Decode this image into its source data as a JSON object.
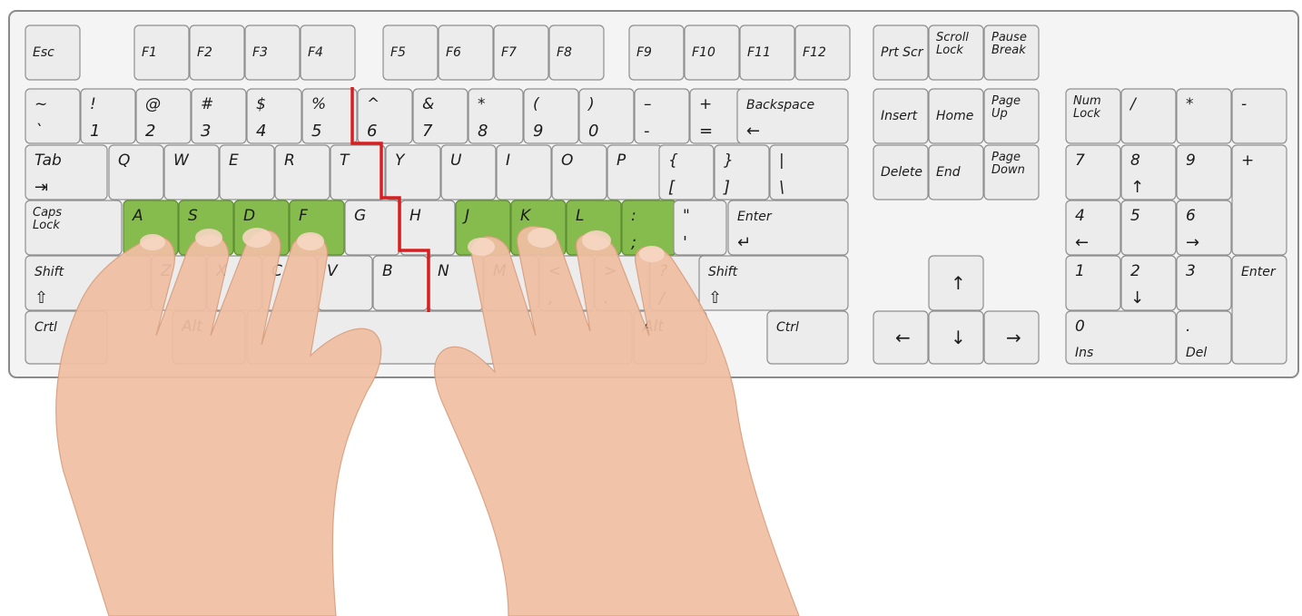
{
  "keyboard": {
    "home_key_color": "#86bb4e",
    "divider_color": "#d81e1e",
    "function_row": [
      {
        "id": "esc",
        "lines": [
          "Esc"
        ]
      },
      {
        "id": "f1",
        "lines": [
          "F1"
        ]
      },
      {
        "id": "f2",
        "lines": [
          "F2"
        ]
      },
      {
        "id": "f3",
        "lines": [
          "F3"
        ]
      },
      {
        "id": "f4",
        "lines": [
          "F4"
        ]
      },
      {
        "id": "f5",
        "lines": [
          "F5"
        ]
      },
      {
        "id": "f6",
        "lines": [
          "F6"
        ]
      },
      {
        "id": "f7",
        "lines": [
          "F7"
        ]
      },
      {
        "id": "f8",
        "lines": [
          "F8"
        ]
      },
      {
        "id": "f9",
        "lines": [
          "F9"
        ]
      },
      {
        "id": "f10",
        "lines": [
          "F10"
        ]
      },
      {
        "id": "f11",
        "lines": [
          "F11"
        ]
      },
      {
        "id": "f12",
        "lines": [
          "F12"
        ]
      }
    ],
    "number_row": [
      {
        "id": "tilde",
        "top": "~",
        "bottom": "`"
      },
      {
        "id": "1",
        "top": "!",
        "bottom": "1"
      },
      {
        "id": "2",
        "top": "@",
        "bottom": "2"
      },
      {
        "id": "3",
        "top": "#",
        "bottom": "3"
      },
      {
        "id": "4",
        "top": "$",
        "bottom": "4"
      },
      {
        "id": "5",
        "top": "%",
        "bottom": "5"
      },
      {
        "id": "6",
        "top": "^",
        "bottom": "6"
      },
      {
        "id": "7",
        "top": "&",
        "bottom": "7"
      },
      {
        "id": "8",
        "top": "*",
        "bottom": "8"
      },
      {
        "id": "9",
        "top": "(",
        "bottom": "9"
      },
      {
        "id": "0",
        "top": ")",
        "bottom": "0"
      },
      {
        "id": "minus",
        "top": "–",
        "bottom": "-"
      },
      {
        "id": "equals",
        "top": "+",
        "bottom": "="
      },
      {
        "id": "backspace",
        "top": "Backspace",
        "bottom": "←"
      }
    ],
    "top_row": [
      {
        "id": "tab",
        "top": "Tab",
        "bottom": "⇥"
      },
      {
        "id": "q",
        "top": "Q"
      },
      {
        "id": "w",
        "top": "W"
      },
      {
        "id": "e",
        "top": "E"
      },
      {
        "id": "r",
        "top": "R"
      },
      {
        "id": "t",
        "top": "T"
      },
      {
        "id": "y",
        "top": "Y"
      },
      {
        "id": "u",
        "top": "U"
      },
      {
        "id": "i",
        "top": "I"
      },
      {
        "id": "o",
        "top": "O"
      },
      {
        "id": "p",
        "top": "P"
      },
      {
        "id": "lbrace",
        "top": "{",
        "bottom": "["
      },
      {
        "id": "rbrace",
        "top": "}",
        "bottom": "]"
      },
      {
        "id": "pipe",
        "top": "|",
        "bottom": "\\"
      }
    ],
    "home_row": [
      {
        "id": "caps",
        "lines": [
          "Caps",
          "Lock"
        ]
      },
      {
        "id": "a",
        "top": "A",
        "home": true
      },
      {
        "id": "s",
        "top": "S",
        "home": true
      },
      {
        "id": "d",
        "top": "D",
        "home": true
      },
      {
        "id": "f",
        "top": "F",
        "home": true
      },
      {
        "id": "g",
        "top": "G"
      },
      {
        "id": "h",
        "top": "H"
      },
      {
        "id": "j",
        "top": "J",
        "home": true
      },
      {
        "id": "k",
        "top": "K",
        "home": true
      },
      {
        "id": "l",
        "top": "L",
        "home": true
      },
      {
        "id": "semicolon",
        "top": ":",
        "bottom": ";",
        "home": true
      },
      {
        "id": "quote",
        "top": "\"",
        "bottom": "'"
      },
      {
        "id": "enter",
        "top": "Enter",
        "bottom": "↵"
      }
    ],
    "bottom_row": [
      {
        "id": "lshift",
        "top": "Shift",
        "bottom": "⇧"
      },
      {
        "id": "z",
        "top": "Z"
      },
      {
        "id": "x",
        "top": "X"
      },
      {
        "id": "c",
        "top": "C"
      },
      {
        "id": "v",
        "top": "V"
      },
      {
        "id": "b",
        "top": "B"
      },
      {
        "id": "n",
        "top": "N"
      },
      {
        "id": "m",
        "top": "M"
      },
      {
        "id": "comma",
        "top": "<",
        "bottom": ","
      },
      {
        "id": "period",
        "top": ">",
        "bottom": "."
      },
      {
        "id": "slash",
        "top": "?",
        "bottom": "/"
      },
      {
        "id": "rshift",
        "top": "Shift",
        "bottom": "⇧"
      }
    ],
    "space_row": [
      {
        "id": "lctrl",
        "top": "Crtl"
      },
      {
        "id": "lalt",
        "top": "Alt"
      },
      {
        "id": "space",
        "top": ""
      },
      {
        "id": "ralt",
        "top": "Alt"
      },
      {
        "id": "rctrl",
        "top": "Ctrl"
      }
    ],
    "nav_cluster": [
      {
        "id": "prtscr",
        "lines": [
          "Prt Scr"
        ]
      },
      {
        "id": "scrolllock",
        "lines": [
          "Scroll",
          "Lock"
        ]
      },
      {
        "id": "pause",
        "lines": [
          "Pause",
          "Break"
        ]
      },
      {
        "id": "insert",
        "lines": [
          "Insert"
        ]
      },
      {
        "id": "home",
        "lines": [
          "Home"
        ]
      },
      {
        "id": "pageup",
        "lines": [
          "Page",
          "Up"
        ]
      },
      {
        "id": "delete",
        "lines": [
          "Delete"
        ]
      },
      {
        "id": "end",
        "lines": [
          "End"
        ]
      },
      {
        "id": "pagedown",
        "lines": [
          "Page",
          "Down"
        ]
      },
      {
        "id": "arrowup",
        "center": "↑"
      },
      {
        "id": "arrowleft",
        "center": "←"
      },
      {
        "id": "arrowdown",
        "center": "↓"
      },
      {
        "id": "arrowright",
        "center": "→"
      }
    ],
    "numpad": [
      {
        "id": "numlock",
        "lines": [
          "Num",
          "Lock"
        ]
      },
      {
        "id": "np-slash",
        "top": "/"
      },
      {
        "id": "np-star",
        "top": "*"
      },
      {
        "id": "np-minus",
        "top": "-"
      },
      {
        "id": "np7",
        "top": "7"
      },
      {
        "id": "np8",
        "top": "8",
        "bottom": "↑"
      },
      {
        "id": "np9",
        "top": "9"
      },
      {
        "id": "np-plus",
        "top": "+"
      },
      {
        "id": "np4",
        "top": "4",
        "bottom": "←"
      },
      {
        "id": "np5",
        "top": "5"
      },
      {
        "id": "np6",
        "top": "6",
        "bottom": "→"
      },
      {
        "id": "np1",
        "top": "1"
      },
      {
        "id": "np2",
        "top": "2",
        "bottom": "↓"
      },
      {
        "id": "np3",
        "top": "3"
      },
      {
        "id": "np-enter",
        "top": "Enter"
      },
      {
        "id": "np0",
        "top": "0",
        "bottom": "Ins"
      },
      {
        "id": "np-dot",
        "top": ".",
        "bottom": "Del"
      }
    ]
  }
}
